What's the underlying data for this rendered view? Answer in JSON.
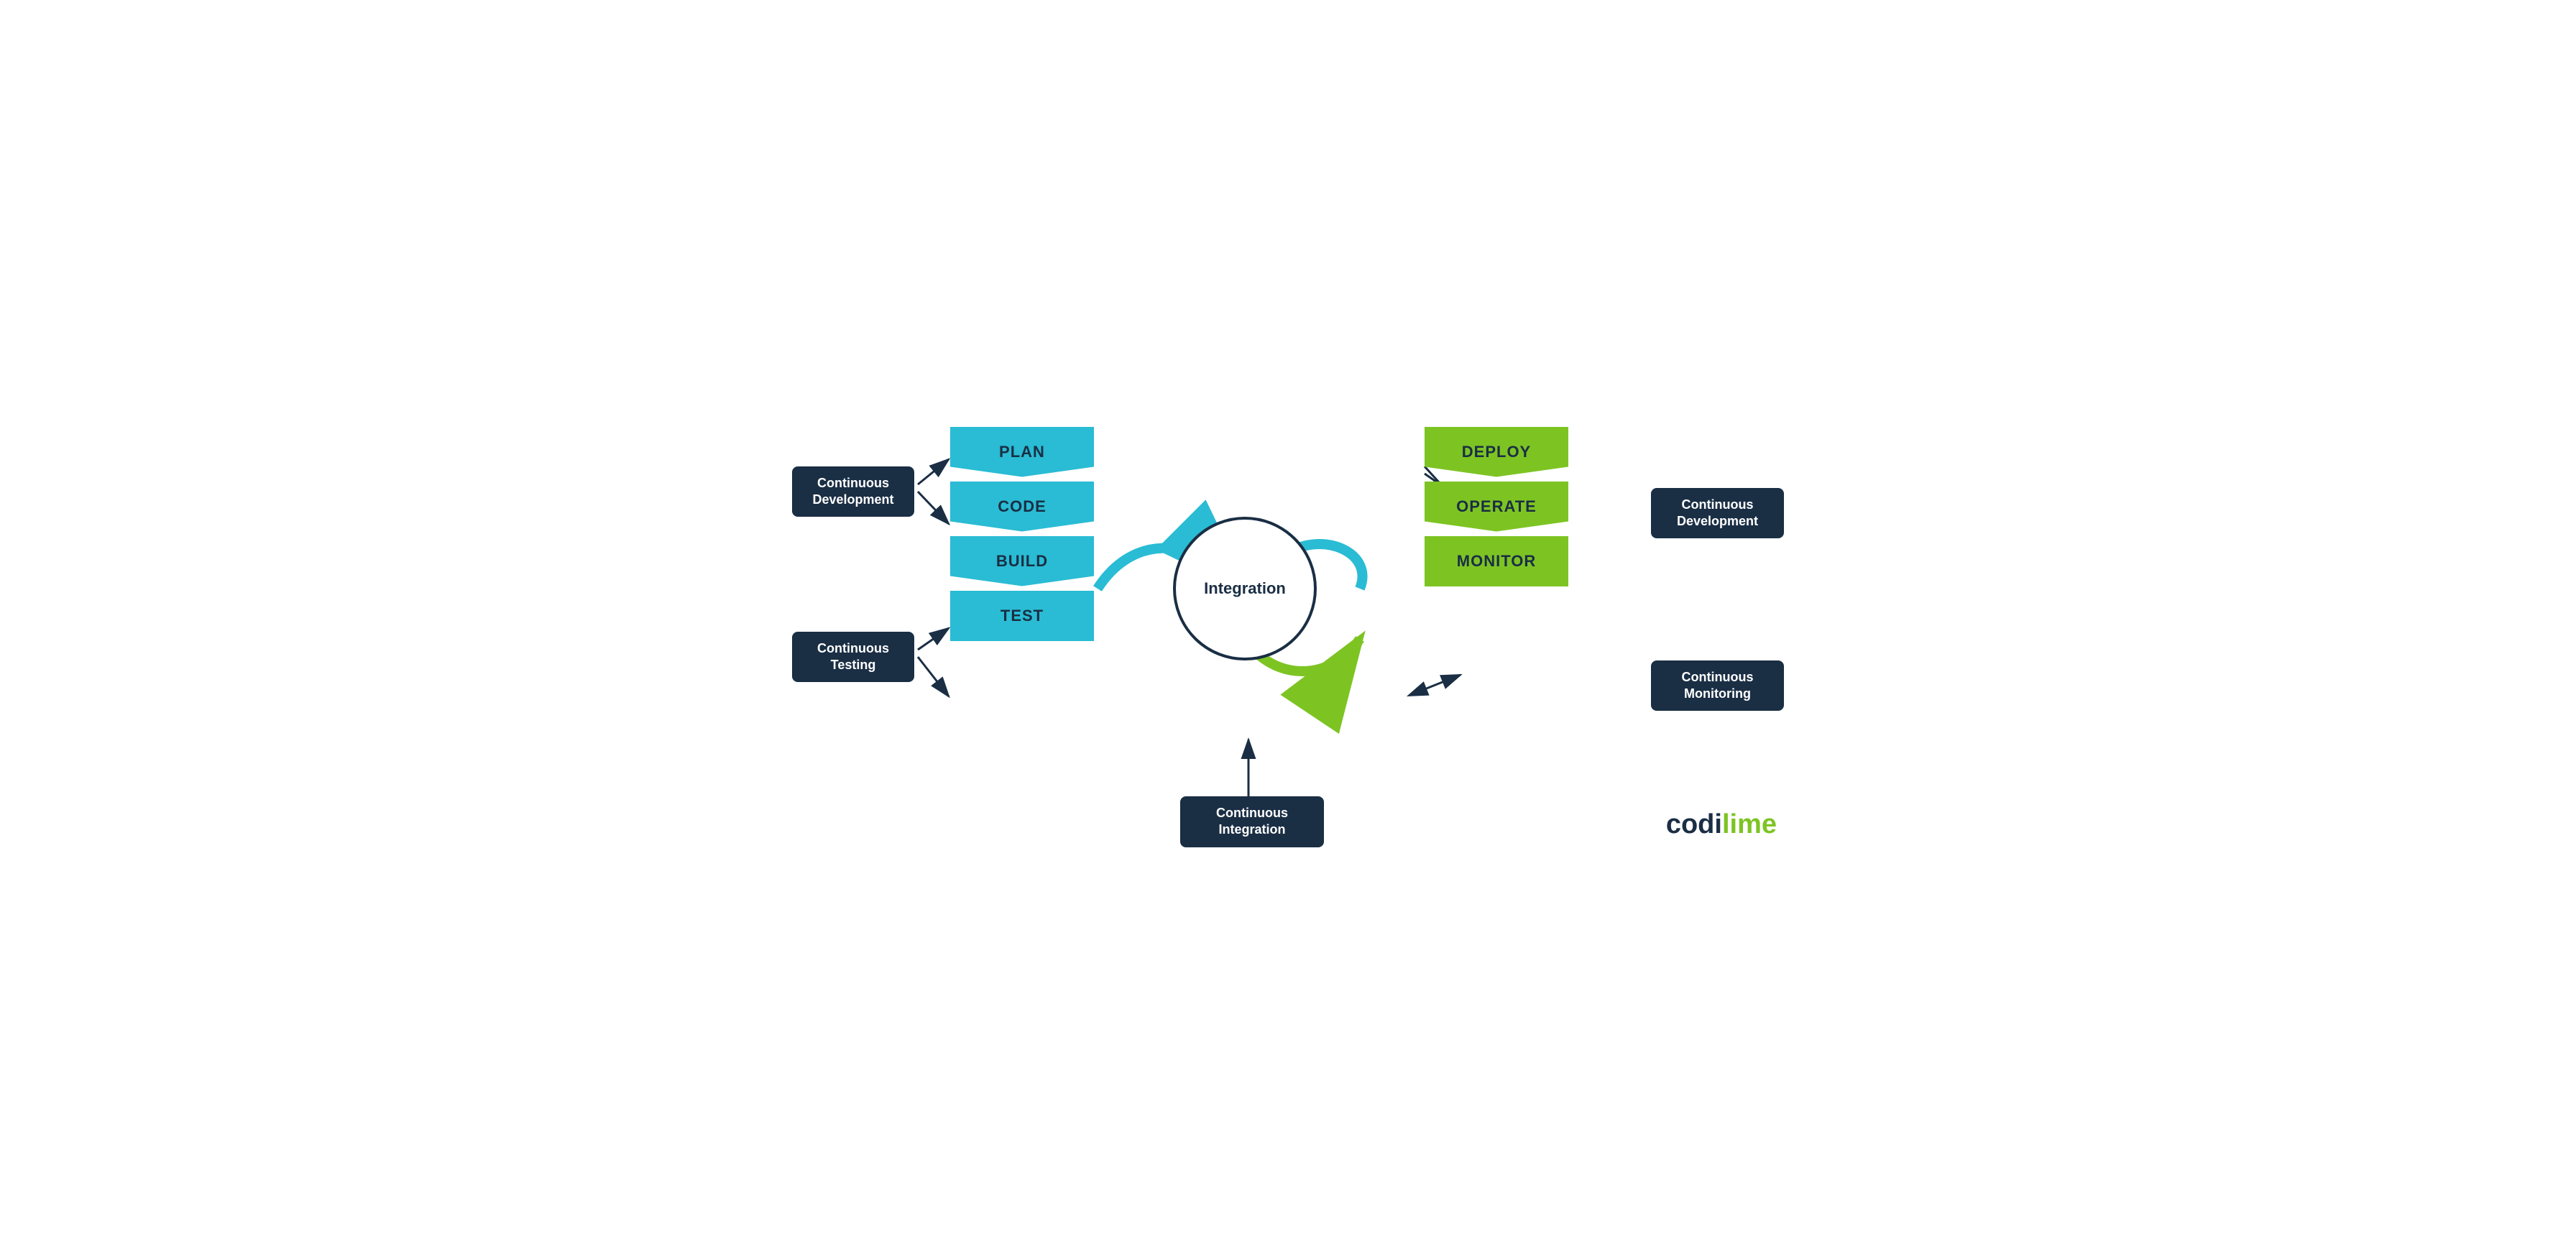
{
  "labels": {
    "continuous_dev_left": "Continuous\nDevelopment",
    "continuous_testing": "Continuous\nTesting",
    "continuous_dev_right": "Continuous\nDevelopment",
    "continuous_monitoring": "Continuous\nMonitoring",
    "continuous_integration": "Continuous\nIntegration",
    "integration_circle": "Integration"
  },
  "cyan_blocks": [
    "PLAN",
    "CODE",
    "BUILD",
    "TEST"
  ],
  "green_blocks": [
    "DEPLOY",
    "OPERATE",
    "MONITOR"
  ],
  "logo": {
    "codi": "codi",
    "lime": "lime"
  },
  "colors": {
    "dark_navy": "#1a2e44",
    "cyan": "#29bcd4",
    "green": "#7dc423",
    "white": "#ffffff"
  }
}
